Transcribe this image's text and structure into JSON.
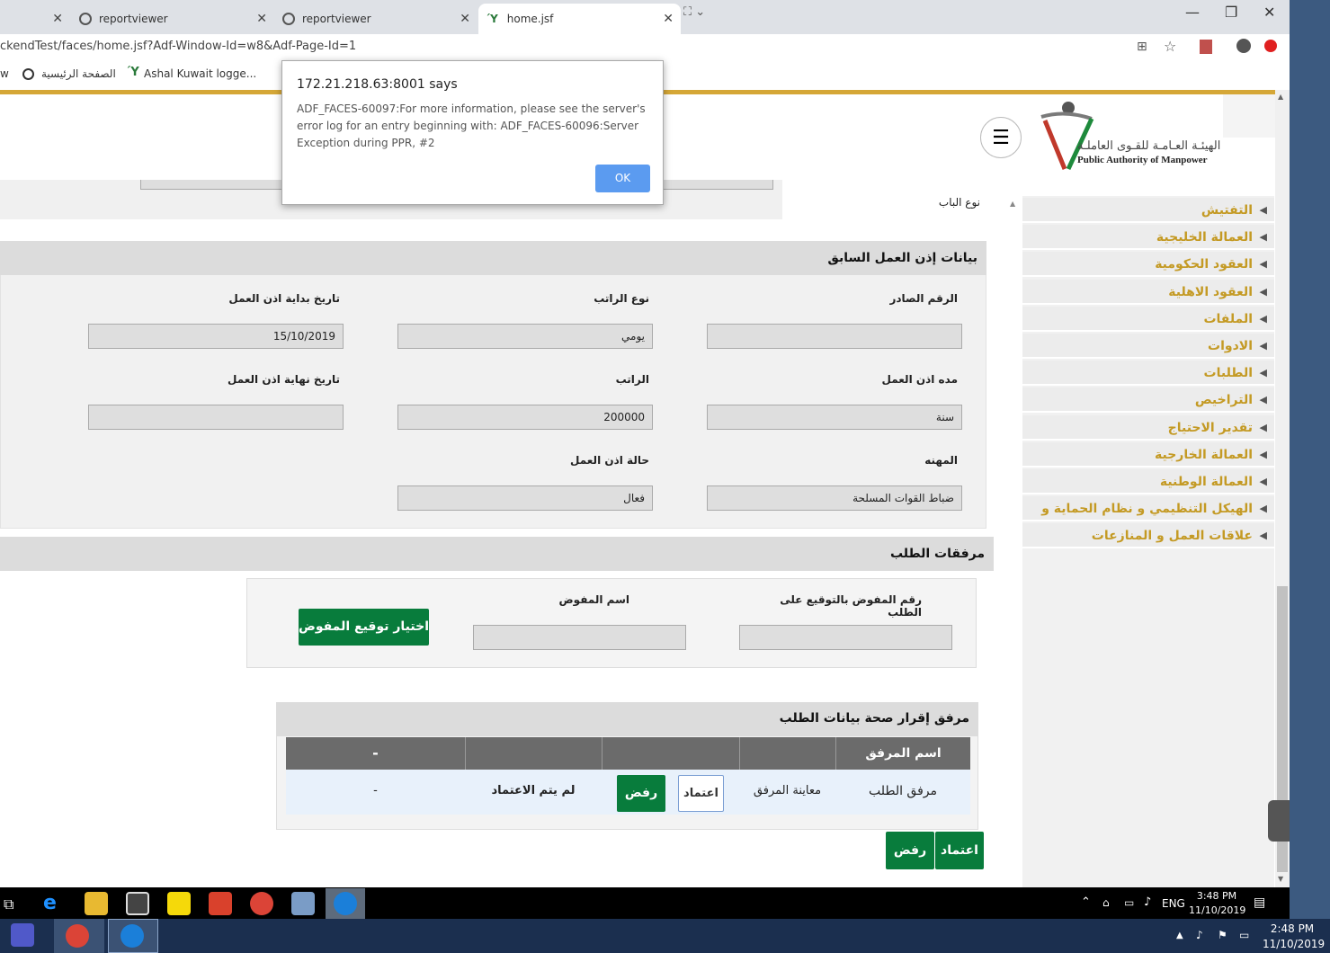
{
  "browser": {
    "tabs": [
      {
        "label": "",
        "icon": "close-icon"
      },
      {
        "label": "reportviewer",
        "icon": "globe-icon"
      },
      {
        "label": "reportviewer",
        "icon": "globe-icon"
      },
      {
        "label": "home.jsf",
        "icon": "pam-favicon-icon"
      }
    ],
    "address": "ckendTest/faces/home.jsf?Adf-Window-Id=w8&Adf-Page-Id=1",
    "bookmarks": [
      {
        "label": "w"
      },
      {
        "label": "الصفحة الرئيسية"
      },
      {
        "label": "Ashal Kuwait logge..."
      }
    ]
  },
  "header": {
    "logo_ar": "الهيئـة العـامـة للقـوى العاملـة",
    "logo_en": "Public Authority of Manpower",
    "menu_icon": "hamburger-icon"
  },
  "top_fragment": {
    "door_type_label": "نوع الباب"
  },
  "sidebar": {
    "items": [
      {
        "label": "التفتيش"
      },
      {
        "label": "العمالة الخليجية"
      },
      {
        "label": "العقود الحكومية"
      },
      {
        "label": "العقود الاهلية"
      },
      {
        "label": "الملفات"
      },
      {
        "label": "الادوات"
      },
      {
        "label": "الطلبات"
      },
      {
        "label": "التراخيص"
      },
      {
        "label": "تقدير الاحتياج"
      },
      {
        "label": "العمالة الخارجية"
      },
      {
        "label": "العمالة الوطنية"
      },
      {
        "label": "الهيكل التنظيمي و نظام الحماية و الامن"
      },
      {
        "label": "علاقات العمل و المنازعات"
      }
    ]
  },
  "prev_permit": {
    "title": "بيانات إذن العمل السابق",
    "issued_no_label": "الرقم الصادر",
    "issued_no_value": "",
    "salary_type_label": "نوع الراتب",
    "salary_type_value": "يومي",
    "start_date_label": "تاريخ بداية اذن العمل",
    "start_date_value": "15/10/2019",
    "duration_label": "مده اذن العمل",
    "duration_value": "سنة",
    "salary_label": "الراتب",
    "salary_value": "200000",
    "end_date_label": "تاريخ نهاية اذن العمل",
    "end_date_value": "",
    "profession_label": "المهنه",
    "profession_value": "ضباط القوات المسلحة",
    "status_label": "حالة اذن العمل",
    "status_value": "فعال"
  },
  "attachments": {
    "title": "مرفقات الطلب",
    "delegate_no_label": "رقم المفوض بالتوقيع على الطلب",
    "delegate_no_value": "",
    "delegate_name_label": "اسم المفوض",
    "delegate_name_value": "",
    "choose_signature_label": "اختيار توقيع المفوض"
  },
  "attachment_table": {
    "title": "مرفق إقرار صحة بيانات الطلب",
    "headers": [
      "اسم المرفق",
      "",
      "",
      "",
      "-"
    ],
    "row": {
      "name": "مرفق الطلب",
      "preview": "معاينة المرفق",
      "approve": "اعتماد",
      "reject": "رفض",
      "status": "لم يتم الاعتماد",
      "dash": "-"
    }
  },
  "bottom_actions": {
    "approve": "اعتماد",
    "reject": "رفض"
  },
  "dialog": {
    "title": "172.21.218.63:8001 says",
    "message": "ADF_FACES-60097:For more information, please see the server's error log for an entry beginning with: ADF_FACES-60096:Server Exception during PPR, #2",
    "ok": "OK"
  },
  "taskbar": {
    "lang": "ENG",
    "time1": "3:48 PM",
    "date1": "11/10/2019",
    "time2": "2:48 PM",
    "date2": "11/10/2019"
  },
  "colors": {
    "accent_gold": "#d5a737",
    "sidebar_text": "#c49a24",
    "button_green": "#087c3c",
    "dialog_ok": "#5b9bf0"
  }
}
